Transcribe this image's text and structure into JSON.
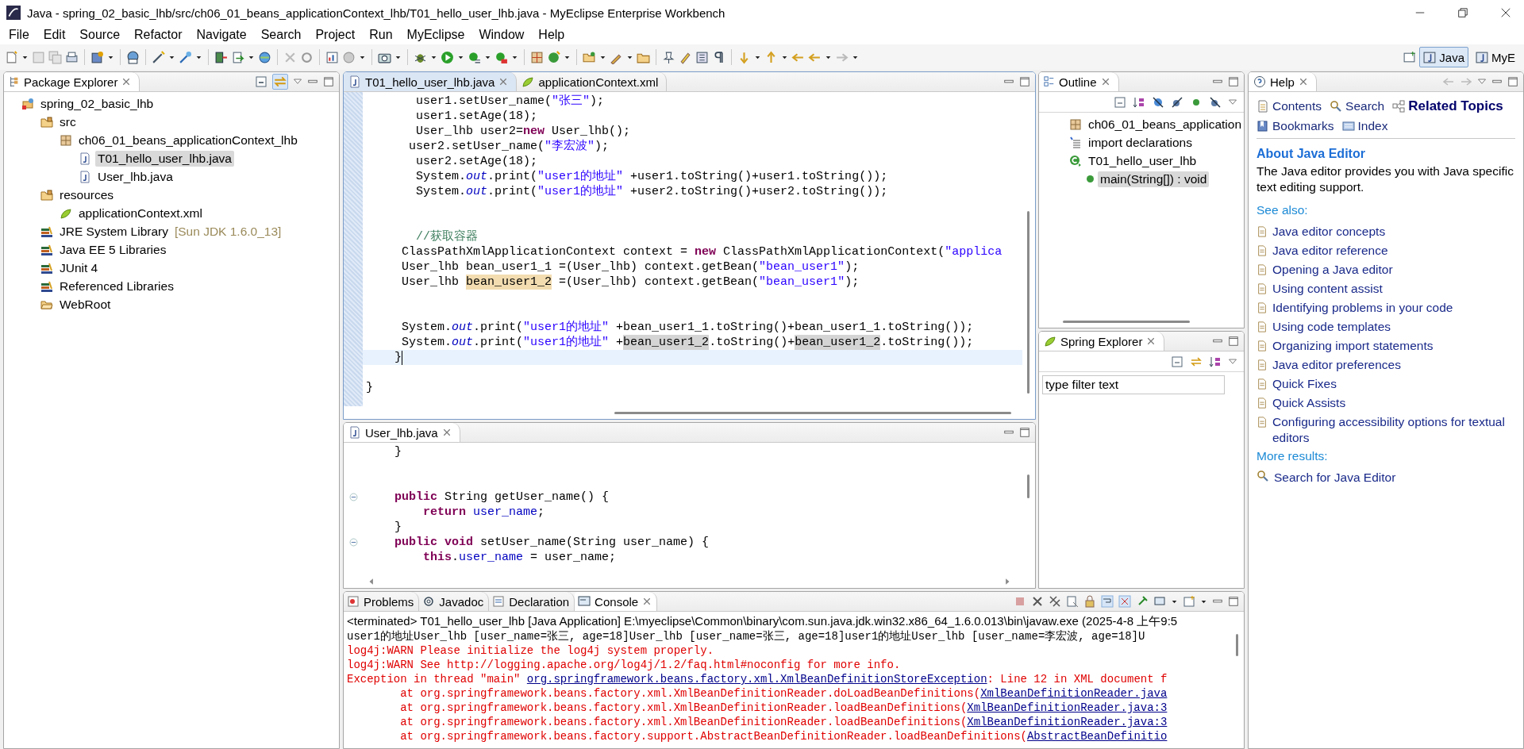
{
  "window": {
    "title": "Java - spring_02_basic_lhb/src/ch06_01_beans_applicationContext_lhb/T01_hello_user_lhb.java - MyEclipse Enterprise Workbench"
  },
  "menu": [
    "File",
    "Edit",
    "Source",
    "Refactor",
    "Navigate",
    "Search",
    "Project",
    "Run",
    "MyEclipse",
    "Window",
    "Help"
  ],
  "perspectives": [
    {
      "label": "Java",
      "selected": true
    },
    {
      "label": "MyE",
      "selected": false
    }
  ],
  "package_explorer": {
    "title": "Package Explorer",
    "tree": [
      {
        "label": "spring_02_basic_lhb",
        "kind": "project",
        "selected": false,
        "children": [
          {
            "label": "src",
            "kind": "folder",
            "selected": false,
            "children": [
              {
                "label": "ch06_01_beans_applicationContext_lhb",
                "kind": "package",
                "selected": false,
                "children": [
                  {
                    "label": "T01_hello_user_lhb.java",
                    "kind": "java",
                    "selected": true
                  },
                  {
                    "label": "User_lhb.java",
                    "kind": "java",
                    "selected": false
                  }
                ]
              }
            ]
          },
          {
            "label": "resources",
            "kind": "folder",
            "selected": false,
            "children": [
              {
                "label": "applicationContext.xml",
                "kind": "xml",
                "selected": false
              }
            ]
          },
          {
            "label": "JRE System Library",
            "decoration": "[Sun JDK 1.6.0_13]",
            "kind": "library",
            "selected": false
          },
          {
            "label": "Java EE 5 Libraries",
            "kind": "library",
            "selected": false
          },
          {
            "label": "JUnit 4",
            "kind": "library",
            "selected": false
          },
          {
            "label": "Referenced Libraries",
            "kind": "library",
            "selected": false
          },
          {
            "label": "WebRoot",
            "kind": "webfolder",
            "selected": false
          }
        ]
      }
    ]
  },
  "editor": {
    "tabs": [
      {
        "label": "T01_hello_user_lhb.java",
        "kind": "java",
        "selected": true
      },
      {
        "label": "applicationContext.xml",
        "kind": "xml",
        "selected": false
      }
    ],
    "lines": [
      {
        "current": false,
        "tokens": [
          {
            "kind": "plain",
            "text": "       user1.setUser_name("
          },
          {
            "kind": "string",
            "text": "\"张三\""
          },
          {
            "kind": "plain",
            "text": ");"
          }
        ]
      },
      {
        "current": false,
        "tokens": [
          {
            "kind": "plain",
            "text": "       user1.setAge(18);"
          }
        ]
      },
      {
        "current": false,
        "tokens": [
          {
            "kind": "plain",
            "text": "       User_lhb user2="
          },
          {
            "kind": "keyword",
            "text": "new"
          },
          {
            "kind": "plain",
            "text": " User_lhb();"
          }
        ]
      },
      {
        "current": false,
        "tokens": [
          {
            "kind": "plain",
            "text": "      user2.setUser_name("
          },
          {
            "kind": "string",
            "text": "\"李宏波\""
          },
          {
            "kind": "plain",
            "text": ");"
          }
        ]
      },
      {
        "current": false,
        "tokens": [
          {
            "kind": "plain",
            "text": "       user2.setAge(18);"
          }
        ]
      },
      {
        "current": false,
        "tokens": [
          {
            "kind": "plain",
            "text": "       System."
          },
          {
            "kind": "field",
            "text": "out"
          },
          {
            "kind": "plain",
            "text": ".print("
          },
          {
            "kind": "string",
            "text": "\"user1的地址\""
          },
          {
            "kind": "plain",
            "text": " +user1.toString()+user1.toString());"
          }
        ]
      },
      {
        "current": false,
        "tokens": [
          {
            "kind": "plain",
            "text": "       System."
          },
          {
            "kind": "field",
            "text": "out"
          },
          {
            "kind": "plain",
            "text": ".print("
          },
          {
            "kind": "string",
            "text": "\"user1的地址\""
          },
          {
            "kind": "plain",
            "text": " +user2.toString()+user2.toString());"
          }
        ]
      },
      {
        "current": false
      },
      {
        "current": false
      },
      {
        "current": false,
        "tokens": [
          {
            "kind": "comment",
            "text": "       //获取容器"
          }
        ]
      },
      {
        "current": false,
        "tokens": [
          {
            "kind": "plain",
            "text": "     ClassPathXmlApplicationContext context = "
          },
          {
            "kind": "keyword",
            "text": "new"
          },
          {
            "kind": "plain",
            "text": " ClassPathXmlApplicationContext("
          },
          {
            "kind": "string",
            "text": "\"applica"
          }
        ]
      },
      {
        "current": false,
        "tokens": [
          {
            "kind": "plain",
            "text": "     User_lhb bean_user1_1 =(User_lhb) context.getBean("
          },
          {
            "kind": "string",
            "text": "\"bean_user1\""
          },
          {
            "kind": "plain",
            "text": ");"
          }
        ]
      },
      {
        "current": false,
        "tokens": [
          {
            "kind": "plain",
            "text": "     User_lhb "
          },
          {
            "kind": "write",
            "text": "bean_user1_2"
          },
          {
            "kind": "plain",
            "text": " =(User_lhb) context.getBean("
          },
          {
            "kind": "string",
            "text": "\"bean_user1\""
          },
          {
            "kind": "plain",
            "text": ");"
          }
        ]
      },
      {
        "current": false
      },
      {
        "current": false
      },
      {
        "current": false,
        "tokens": [
          {
            "kind": "plain",
            "text": "     System."
          },
          {
            "kind": "field",
            "text": "out"
          },
          {
            "kind": "plain",
            "text": ".print("
          },
          {
            "kind": "string",
            "text": "\"user1的地址\""
          },
          {
            "kind": "plain",
            "text": " +bean_user1_1.toString()+bean_user1_1.toString());"
          }
        ]
      },
      {
        "current": false,
        "tokens": [
          {
            "kind": "plain",
            "text": "     System."
          },
          {
            "kind": "field",
            "text": "out"
          },
          {
            "kind": "plain",
            "text": ".print("
          },
          {
            "kind": "string",
            "text": "\"user1的地址\""
          },
          {
            "kind": "plain",
            "text": " +"
          },
          {
            "kind": "read",
            "text": "bean_user1_2"
          },
          {
            "kind": "plain",
            "text": ".toString()+"
          },
          {
            "kind": "read",
            "text": "bean_user1_2"
          },
          {
            "kind": "plain",
            "text": ".toString());"
          }
        ]
      },
      {
        "current": true,
        "tokens": [
          {
            "kind": "plain",
            "text": "    }"
          }
        ]
      },
      {
        "current": false
      },
      {
        "current": false,
        "tokens": [
          {
            "kind": "plain",
            "text": "}"
          }
        ]
      }
    ]
  },
  "editor_2": {
    "tabs": [
      {
        "label": "User_lhb.java",
        "kind": "java",
        "selected": true
      }
    ],
    "lines": [
      {
        "fold": false,
        "tokens": [
          {
            "kind": "plain",
            "text": "    }"
          }
        ]
      },
      {
        "fold": false
      },
      {
        "fold": false
      },
      {
        "fold": true,
        "tokens": [
          {
            "kind": "keyword",
            "text": "    public"
          },
          {
            "kind": "plain",
            "text": " String getUser_name() {"
          }
        ]
      },
      {
        "fold": false,
        "tokens": [
          {
            "kind": "keyword",
            "text": "        return "
          },
          {
            "kind": "member",
            "text": "user_name"
          },
          {
            "kind": "plain",
            "text": ";"
          }
        ]
      },
      {
        "fold": false,
        "tokens": [
          {
            "kind": "plain",
            "text": "    }"
          }
        ]
      },
      {
        "fold": true,
        "tokens": [
          {
            "kind": "keyword",
            "text": "    public void"
          },
          {
            "kind": "plain",
            "text": " setUser_name(String user_name) {"
          }
        ]
      },
      {
        "fold": false,
        "tokens": [
          {
            "kind": "keyword",
            "text": "        this"
          },
          {
            "kind": "plain",
            "text": "."
          },
          {
            "kind": "member",
            "text": "user_name"
          },
          {
            "kind": "plain",
            "text": " = user_name;"
          }
        ]
      }
    ]
  },
  "outline": {
    "title": "Outline",
    "tree": [
      {
        "label": "ch06_01_beans_application",
        "kind": "package",
        "selected": false
      },
      {
        "label": "import declarations",
        "kind": "imports",
        "selected": false
      },
      {
        "label": "T01_hello_user_lhb",
        "kind": "class",
        "selected": false,
        "children": [
          {
            "label": "main(String[]) : void",
            "kind": "method",
            "selected": true
          }
        ]
      }
    ]
  },
  "spring_explorer": {
    "title": "Spring Explorer",
    "filter": {
      "value": "type filter text"
    }
  },
  "help": {
    "title": "Help",
    "nav": [
      {
        "label": "Contents",
        "kind": "contents",
        "selected": false
      },
      {
        "label": "Search",
        "kind": "search",
        "selected": false
      },
      {
        "label": "Related Topics",
        "kind": "related",
        "selected": true
      },
      {
        "label": "Bookmarks",
        "kind": "bookmarks",
        "selected": false
      },
      {
        "label": "Index",
        "kind": "index",
        "selected": false
      }
    ],
    "heading": "About Java Editor",
    "description": "The Java editor provides you with Java specific text editing support.",
    "see_also": "See also:",
    "links": [
      "Java editor concepts",
      "Java editor reference",
      "Opening a Java editor",
      "Using content assist",
      "Identifying problems in your code",
      "Using code templates",
      "Organizing import statements",
      "Java editor preferences",
      "Quick Fixes",
      "Quick Assists",
      "Configuring accessibility options for textual editors"
    ],
    "more_results": "More results:",
    "search_link": "Search for Java Editor"
  },
  "console": {
    "tabs": [
      {
        "label": "Problems",
        "kind": "problems",
        "selected": false
      },
      {
        "label": "Javadoc",
        "kind": "javadoc",
        "selected": false
      },
      {
        "label": "Declaration",
        "kind": "declaration",
        "selected": false
      },
      {
        "label": "Console",
        "kind": "console",
        "selected": true
      }
    ],
    "header": "<terminated> T01_hello_user_lhb [Java Application] E:\\myeclipse\\Common\\binary\\com.sun.java.jdk.win32.x86_64_1.6.0.013\\bin\\javaw.exe (2025-4-8 上午9:5",
    "lines": [
      {
        "kind": "stdout",
        "parts": [
          {
            "text": "user1的地址User_lhb [user_name=张三, age=18]User_lhb [user_name=张三, age=18]user1的地址User_lhb [user_name=李宏波, age=18]U",
            "link": false
          }
        ]
      },
      {
        "kind": "stderr",
        "parts": [
          {
            "text": "log4j:WARN Please initialize the log4j system properly.",
            "link": false
          }
        ]
      },
      {
        "kind": "stderr",
        "parts": [
          {
            "text": "log4j:WARN See http://logging.apache.org/log4j/1.2/faq.html#noconfig for more info.",
            "link": false
          }
        ]
      },
      {
        "kind": "stderr",
        "parts": [
          {
            "text": "Exception in thread \"main\" ",
            "link": false
          },
          {
            "text": "org.springframework.beans.factory.xml.XmlBeanDefinitionStoreException",
            "link": true
          },
          {
            "text": ": Line 12 in XML document f",
            "link": false
          }
        ]
      },
      {
        "kind": "stderr",
        "parts": [
          {
            "text": "        at org.springframework.beans.factory.xml.XmlBeanDefinitionReader.doLoadBeanDefinitions(",
            "link": false
          },
          {
            "text": "XmlBeanDefinitionReader.java",
            "link": true
          }
        ]
      },
      {
        "kind": "stderr",
        "parts": [
          {
            "text": "        at org.springframework.beans.factory.xml.XmlBeanDefinitionReader.loadBeanDefinitions(",
            "link": false
          },
          {
            "text": "XmlBeanDefinitionReader.java:3",
            "link": true
          }
        ]
      },
      {
        "kind": "stderr",
        "parts": [
          {
            "text": "        at org.springframework.beans.factory.xml.XmlBeanDefinitionReader.loadBeanDefinitions(",
            "link": false
          },
          {
            "text": "XmlBeanDefinitionReader.java:3",
            "link": true
          }
        ]
      },
      {
        "kind": "stderr",
        "parts": [
          {
            "text": "        at org.springframework.beans.factory.support.AbstractBeanDefinitionReader.loadBeanDefinitions(",
            "link": false
          },
          {
            "text": "AbstractBeanDefinitio",
            "link": true
          }
        ]
      }
    ]
  }
}
